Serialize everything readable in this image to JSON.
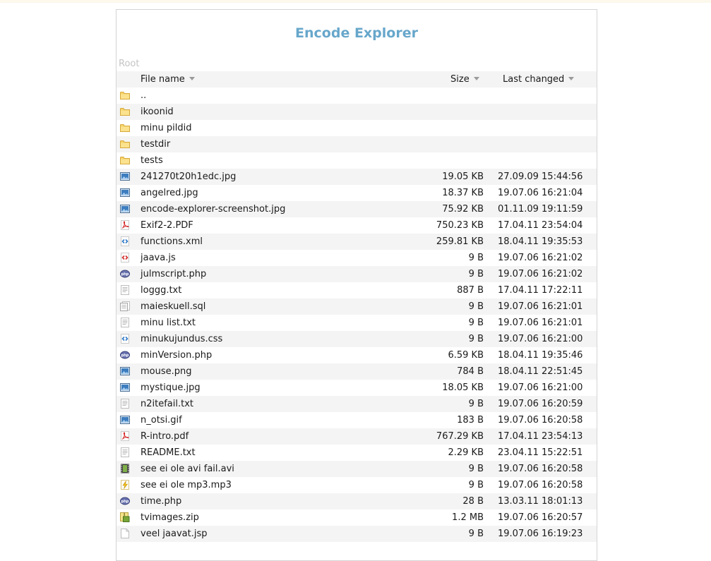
{
  "app": {
    "title": "Encode Explorer"
  },
  "breadcrumb": {
    "root": "Root"
  },
  "columns": {
    "name": "File name",
    "size": "Size",
    "modified": "Last changed"
  },
  "files": [
    {
      "name": "..",
      "size": "",
      "modified": "",
      "icon": "folder-icon"
    },
    {
      "name": "ikoonid",
      "size": "",
      "modified": "",
      "icon": "folder-icon"
    },
    {
      "name": "minu pildid",
      "size": "",
      "modified": "",
      "icon": "folder-icon"
    },
    {
      "name": "testdir",
      "size": "",
      "modified": "",
      "icon": "folder-icon"
    },
    {
      "name": "tests",
      "size": "",
      "modified": "",
      "icon": "folder-icon"
    },
    {
      "name": "241270t20h1edc.jpg",
      "size": "19.05 KB",
      "modified": "27.09.09 15:44:56",
      "icon": "image-icon"
    },
    {
      "name": "angelred.jpg",
      "size": "18.37 KB",
      "modified": "19.07.06 16:21:04",
      "icon": "image-icon"
    },
    {
      "name": "encode-explorer-screenshot.jpg",
      "size": "75.92 KB",
      "modified": "01.11.09 19:11:59",
      "icon": "image-icon"
    },
    {
      "name": "Exif2-2.PDF",
      "size": "750.23 KB",
      "modified": "17.04.11 23:54:04",
      "icon": "pdf-icon"
    },
    {
      "name": "functions.xml",
      "size": "259.81 KB",
      "modified": "18.04.11 19:35:53",
      "icon": "code-icon"
    },
    {
      "name": "jaava.js",
      "size": "9 B",
      "modified": "19.07.06 16:21:02",
      "icon": "script-icon"
    },
    {
      "name": "julmscript.php",
      "size": "9 B",
      "modified": "19.07.06 16:21:02",
      "icon": "php-icon"
    },
    {
      "name": "loggg.txt",
      "size": "887 B",
      "modified": "17.04.11 17:22:11",
      "icon": "text-icon"
    },
    {
      "name": "maieskuell.sql",
      "size": "9 B",
      "modified": "19.07.06 16:21:01",
      "icon": "sql-icon"
    },
    {
      "name": "minu list.txt",
      "size": "9 B",
      "modified": "19.07.06 16:21:01",
      "icon": "text-icon"
    },
    {
      "name": "minukujundus.css",
      "size": "9 B",
      "modified": "19.07.06 16:21:00",
      "icon": "code-icon"
    },
    {
      "name": "minVersion.php",
      "size": "6.59 KB",
      "modified": "18.04.11 19:35:46",
      "icon": "php-icon"
    },
    {
      "name": "mouse.png",
      "size": "784 B",
      "modified": "18.04.11 22:51:45",
      "icon": "image-icon"
    },
    {
      "name": "mystique.jpg",
      "size": "18.05 KB",
      "modified": "19.07.06 16:21:00",
      "icon": "image-icon"
    },
    {
      "name": "n2itefail.txt",
      "size": "9 B",
      "modified": "19.07.06 16:20:59",
      "icon": "text-icon"
    },
    {
      "name": "n_otsi.gif",
      "size": "183 B",
      "modified": "19.07.06 16:20:58",
      "icon": "image-icon"
    },
    {
      "name": "R-intro.pdf",
      "size": "767.29 KB",
      "modified": "17.04.11 23:54:13",
      "icon": "pdf-icon"
    },
    {
      "name": "README.txt",
      "size": "2.29 KB",
      "modified": "23.04.11 15:22:51",
      "icon": "text-icon"
    },
    {
      "name": "see ei ole avi fail.avi",
      "size": "9 B",
      "modified": "19.07.06 16:20:58",
      "icon": "video-icon"
    },
    {
      "name": "see ei ole mp3.mp3",
      "size": "9 B",
      "modified": "19.07.06 16:20:58",
      "icon": "audio-icon"
    },
    {
      "name": "time.php",
      "size": "28 B",
      "modified": "13.03.11 18:01:13",
      "icon": "php-icon"
    },
    {
      "name": "tvimages.zip",
      "size": "1.2 MB",
      "modified": "19.07.06 16:20:57",
      "icon": "archive-icon"
    },
    {
      "name": "veel jaavat.jsp",
      "size": "9 B",
      "modified": "19.07.06 16:19:23",
      "icon": "blank-file-icon"
    }
  ],
  "colors": {
    "title": "#67a7cb",
    "stripe": "#f4f4f4",
    "breadcrumb": "#c4c4c4"
  }
}
